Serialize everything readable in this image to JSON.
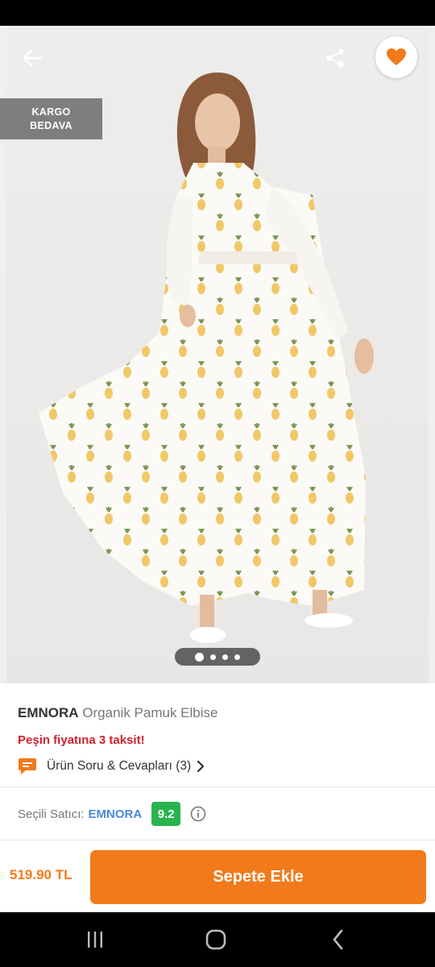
{
  "badge": {
    "line1": "KARGO",
    "line2": "BEDAVA"
  },
  "gallery": {
    "image_count": 4,
    "active_index": 0
  },
  "product": {
    "brand": "EMNORA",
    "name": "Organik Pamuk Elbise",
    "installment": "Peşin fiyatına 3 taksit!",
    "qa_label": "Ürün Soru & Cevapları (3)"
  },
  "seller": {
    "label": "Seçili Satıcı:",
    "name": "EMNORA",
    "score": "9.2"
  },
  "cart": {
    "price": "519.90 TL",
    "button": "Sepete Ekle"
  },
  "icons": {
    "back": "arrow-left-icon",
    "share": "share-icon",
    "favorite": "heart-icon",
    "qa": "chat-bubble-icon",
    "info": "info-circle-icon",
    "nav_recent": "recent-apps-icon",
    "nav_home": "home-icon",
    "nav_back": "back-icon"
  },
  "colors": {
    "accent": "#f27a1a",
    "installment": "#d0202f",
    "seller_link": "#4a8ad6",
    "score_bg": "#27b34d"
  }
}
